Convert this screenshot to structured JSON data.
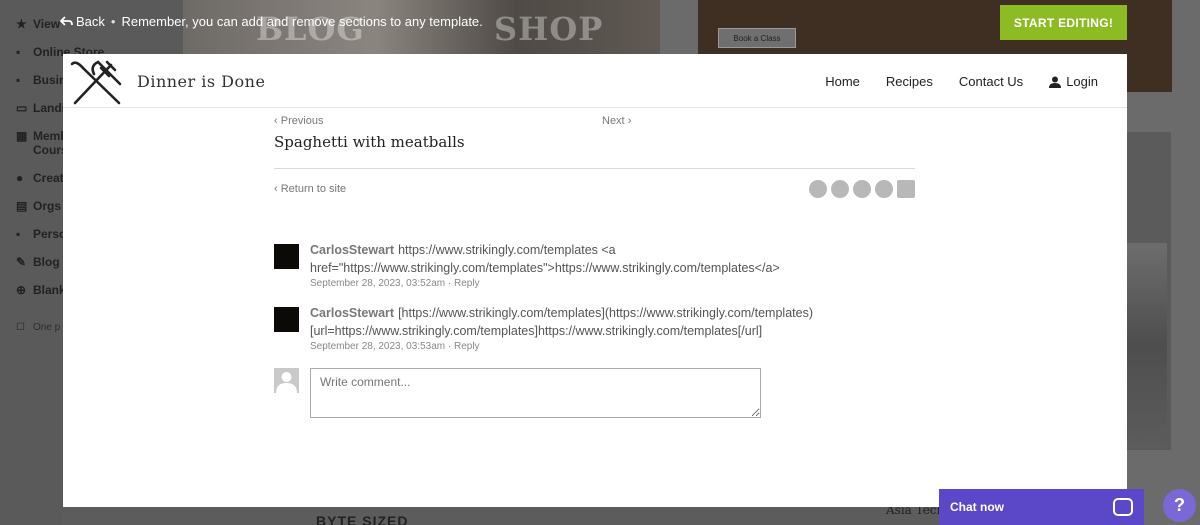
{
  "background": {
    "sidebar_items": [
      {
        "icon": "star-icon",
        "glyph": "★",
        "label": "View"
      },
      {
        "icon": "cart-icon",
        "glyph": "🛒",
        "label": "Online Store"
      },
      {
        "icon": "clipboard-icon",
        "glyph": "📋",
        "label": "Busin"
      },
      {
        "icon": "window-icon",
        "glyph": "▭",
        "label": "Landi"
      },
      {
        "icon": "grid-icon",
        "glyph": "▦",
        "label": "Memb"
      },
      {
        "icon": "",
        "glyph": "",
        "label": "Cours"
      },
      {
        "icon": "palette-icon",
        "glyph": "●",
        "label": "Creat"
      },
      {
        "icon": "building-icon",
        "glyph": "▤",
        "label": "Orgs a"
      },
      {
        "icon": "user-icon",
        "glyph": "👤",
        "label": "Perso"
      },
      {
        "icon": "pen-icon",
        "glyph": "✎",
        "label": "Blog"
      },
      {
        "icon": "plus-circle-icon",
        "glyph": "⊕",
        "label": "Blank"
      },
      {
        "icon": "checkbox-icon",
        "glyph": "☐",
        "label": "One p"
      }
    ],
    "thumb_labels": [
      "BLOG",
      "SHOP"
    ],
    "book_button": "Book a Class",
    "bottom_text": "BYTE SIZED",
    "bottom_text_right": "Asia Tech"
  },
  "topbar": {
    "back_label": "Back",
    "separator": "•",
    "hint": "Remember, you can add and remove sections to any template.",
    "start_button": "START EDITING!"
  },
  "site": {
    "title": "Dinner is Done",
    "logo_icon": "fork-knife-icon",
    "nav": [
      "Home",
      "Recipes",
      "Contact Us",
      "Login"
    ]
  },
  "post": {
    "prev_label": "Previous",
    "next_label": "Next",
    "title": "Spaghetti with meatballs",
    "return_label": "Return to site",
    "share_icons": [
      "facebook-icon",
      "twitter-icon",
      "linkedin-icon",
      "email-icon",
      "rss-icon"
    ]
  },
  "comments": [
    {
      "author": "CarlosStewart",
      "text_line1": "https://www.strikingly.com/templates <a",
      "text_line2": "href=\"https://www.strikingly.com/templates\">https://www.strikingly.com/templates</a>",
      "date": "September 28, 2023, 03:52am",
      "reply": "Reply"
    },
    {
      "author": "CarlosStewart",
      "text_line1": "[https://www.strikingly.com/templates](https://www.strikingly.com/templates)",
      "text_line2": "[url=https://www.strikingly.com/templates]https://www.strikingly.com/templates[/url]",
      "date": "September 28, 2023, 03:53am",
      "reply": "Reply"
    }
  ],
  "comment_form": {
    "placeholder": "Write comment..."
  },
  "chat": {
    "label": "Chat now",
    "help": "?"
  }
}
